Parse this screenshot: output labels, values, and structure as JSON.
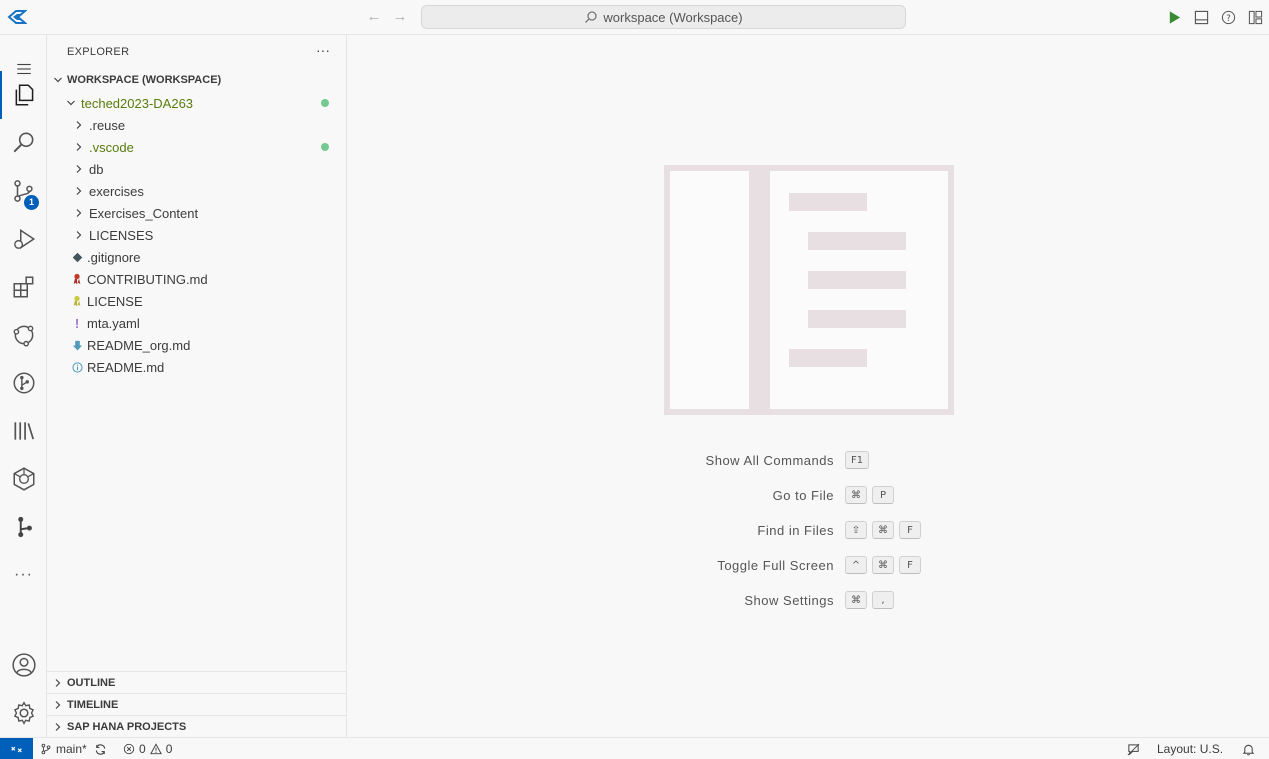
{
  "titlebar": {
    "search_text": "workspace (Workspace)",
    "back_arrow": "←",
    "forward_arrow": "→"
  },
  "activity_bar": {
    "source_control_badge": "1",
    "more_dots": "···",
    "items": [
      "explorer",
      "search",
      "source-control",
      "run-and-debug",
      "extensions",
      "cloud-foundry",
      "git-graph",
      "library",
      "sap-hana",
      "gitlens",
      "more",
      "accounts",
      "manage"
    ]
  },
  "sidebar": {
    "title": "EXPLORER",
    "more_actions": "···",
    "workspace_label": "WORKSPACE (WORKSPACE)",
    "root_folder": "teched2023-DA263",
    "folders": [
      ".reuse",
      ".vscode",
      "db",
      "exercises",
      "Exercises_Content",
      "LICENSES"
    ],
    "files": [
      ".gitignore",
      "CONTRIBUTING.md",
      "LICENSE",
      "mta.yaml",
      "README_org.md",
      "README.md"
    ],
    "sections": [
      "OUTLINE",
      "TIMELINE",
      "SAP HANA PROJECTS"
    ]
  },
  "editor": {
    "shortcuts": [
      {
        "label": "Show All Commands",
        "keys": [
          "F1"
        ]
      },
      {
        "label": "Go to File",
        "keys": [
          "⌘",
          "P"
        ]
      },
      {
        "label": "Find in Files",
        "keys": [
          "⇧",
          "⌘",
          "F"
        ]
      },
      {
        "label": "Toggle Full Screen",
        "keys": [
          "^",
          "⌘",
          "F"
        ]
      },
      {
        "label": "Show Settings",
        "keys": [
          "⌘",
          ","
        ]
      }
    ]
  },
  "statusbar": {
    "branch": "main*",
    "errors": "0",
    "warnings": "0",
    "layout": "Layout: U.S."
  },
  "colors": {
    "accent": "#005fb8",
    "modified": "#587c0c",
    "dot": "#73c991",
    "run": "#388a34"
  }
}
